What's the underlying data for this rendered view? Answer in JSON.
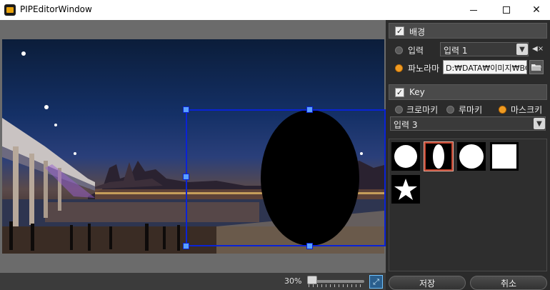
{
  "window": {
    "title": "PIPEditorWindow"
  },
  "preview": {
    "zoom": "30%"
  },
  "background_section": {
    "title": "배경",
    "checked": true,
    "input_radio_label": "입력",
    "input_combo_value": "입력 1",
    "panorama_radio_label": "파노라마",
    "panorama_path": "D:₩DATA₩이미지₩BG.",
    "selected": "panorama"
  },
  "key_section": {
    "title": "Key",
    "checked": true,
    "options": [
      "크로마키",
      "루마키",
      "마스크키"
    ],
    "selected": "마스크키",
    "input_combo_value": "입력 3"
  },
  "mask_shapes": [
    {
      "name": "circle",
      "selected": false
    },
    {
      "name": "ellipse",
      "selected": true
    },
    {
      "name": "circle-large",
      "selected": false
    },
    {
      "name": "square",
      "selected": false
    },
    {
      "name": "star",
      "selected": false
    }
  ],
  "buttons": {
    "save": "저장",
    "cancel": "취소"
  },
  "colors": {
    "accent": "#f09a1e",
    "selection": "#0a23d6",
    "panel_bg": "#2b2b2b"
  }
}
